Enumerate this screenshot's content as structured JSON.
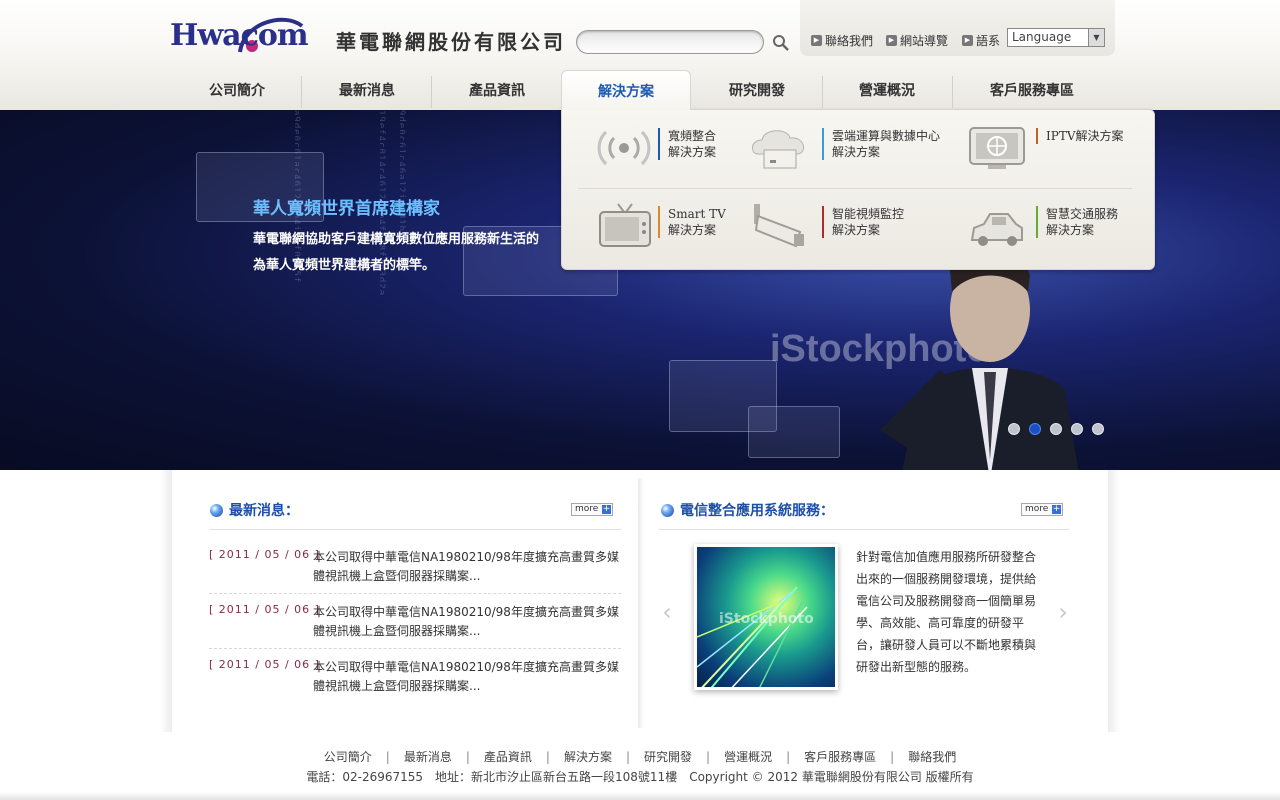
{
  "header": {
    "logo_text": "Hwacom",
    "company_name": "華電聯網股份有限公司",
    "search": {
      "placeholder": "",
      "value": ""
    },
    "util_links": [
      "聯絡我們",
      "網站導覽",
      "語系"
    ],
    "language": "Language"
  },
  "nav": {
    "items": [
      "公司簡介",
      "最新消息",
      "產品資訊",
      "解決方案",
      "研究開發",
      "營運概況",
      "客戶服務專區"
    ],
    "active_index": 3
  },
  "dropdown": {
    "items": [
      {
        "label": "寬頻整合\n解決方案",
        "icon": "wifi-signal-icon",
        "bar": "#1d5bb3"
      },
      {
        "label": "雲端運算與數據中心\n解決方案",
        "icon": "cloud-server-icon",
        "bar": "#3d9ad8"
      },
      {
        "label": "IPTV解決方案",
        "icon": "monitor-globe-icon",
        "bar": "#c0602a"
      },
      {
        "label": "Smart TV\n解決方案",
        "icon": "tv-icon",
        "bar": "#d88a2a"
      },
      {
        "label": "智能視頻監控\n解決方案",
        "icon": "cctv-camera-icon",
        "bar": "#b02a2a"
      },
      {
        "label": "智慧交通服務\n解決方案",
        "icon": "car-icon",
        "bar": "#6aa83a"
      }
    ]
  },
  "banner": {
    "title": "華人寬頻世界首席建構家",
    "line1": "華電聯網協助客戶建構寬頻數位應用服務新生活的",
    "line2": "為華人寬頻世界建構者的標竿。",
    "watermark": "iStockphoto",
    "active_slide": 1,
    "slide_count": 5
  },
  "news": {
    "title": "最新消息：",
    "more": "more",
    "items": [
      {
        "date": "[ 2011 / 05 / 06 ]",
        "text": "本公司取得中華電信NA1980210/98年度擴充高畫質多媒體視訊機上盒暨伺服器採購案..."
      },
      {
        "date": "[ 2011 / 05 / 06 ]",
        "text": "本公司取得中華電信NA1980210/98年度擴充高畫質多媒體視訊機上盒暨伺服器採購案..."
      },
      {
        "date": "[ 2011 / 05 / 06 ]",
        "text": "本公司取得中華電信NA1980210/98年度擴充高畫質多媒體視訊機上盒暨伺服器採購案..."
      }
    ]
  },
  "service": {
    "title": "電信整合應用系統服務：",
    "more": "more",
    "image_watermark": "iStockphoto",
    "description": "針對電信加值應用服務所研發整合出來的一個服務開發環境，提供給電信公司及服務開發商一個簡單易學、高效能、高可靠度的研發平台，讓研發人員可以不斷地累積與研發出新型態的服務。"
  },
  "footer": {
    "links": [
      "公司簡介",
      "最新消息",
      "產品資訊",
      "解決方案",
      "研究開發",
      "營運概況",
      "客戶服務專區",
      "聯絡我們"
    ],
    "info": "電話：02-26967155　地址：新北市汐止區新台五路一段108號11樓　Copyright © 2012 華電聯網股份有限公司 版權所有"
  },
  "colors": {
    "accent": "#1d5bb3",
    "date_red": "#8a2b44",
    "banner_title": "#6cc0ff"
  }
}
